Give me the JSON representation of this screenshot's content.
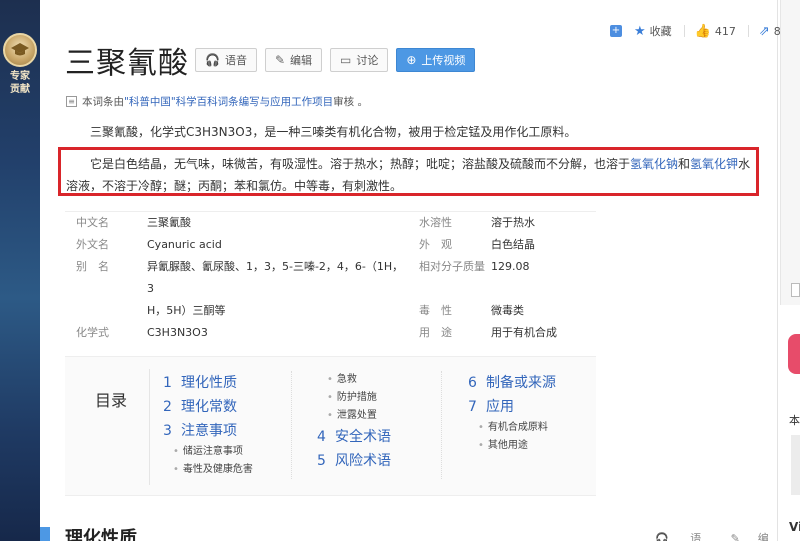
{
  "sidebar": {
    "expert_label": "专家贡献",
    "expert_line1": "专家",
    "expert_line2": "贡献"
  },
  "top_actions": {
    "favorite": "收藏",
    "likes": "417",
    "shares": "8"
  },
  "title": "三聚氰酸",
  "title_buttons": {
    "voice": "语音",
    "edit": "编辑",
    "discuss": "讨论",
    "upload_video": "上传视频"
  },
  "review": {
    "prefix": "本词条由",
    "link": "\"科普中国\"科学百科词条编写与应用工作项目",
    "suffix": " 审核 。"
  },
  "paragraphs": {
    "p1": "三聚氰酸，化学式C3H3N3O3，是一种三嗪类有机化合物，被用于检定锰及用作化工原料。",
    "p2_a": "它是白色结晶，无气味，味微苦，有吸湿性。溶于热水；热醇；吡啶；溶盐酸及硫酸而不分解，也溶于",
    "p2_link1": "氢氧化钠",
    "p2_mid": "和",
    "p2_link2": "氢氧化钾",
    "p2_b": "水溶液，不溶于冷醇；醚；丙酮；苯和氯仿。中等毒，有刺激性。"
  },
  "info_table": {
    "rows": [
      {
        "k": "中文名",
        "v": "三聚氰酸",
        "k2": "水溶性",
        "v2": "溶于热水"
      },
      {
        "k": "外文名",
        "v": "Cyanuric acid",
        "k2": "外　观",
        "v2": "白色结晶"
      },
      {
        "k": "别　名",
        "v": "异氰脲酸、氰尿酸、1，3，5-三嗪-2，4，6-（1H，3",
        "k2": "相对分子质量",
        "v2": "129.08"
      },
      {
        "k": "",
        "v": "H，5H）三酮等",
        "k2": "毒　性",
        "v2": "微毒类"
      },
      {
        "k": "化学式",
        "v": "C3H3N3O3",
        "k2": "用　途",
        "v2": "用于有机合成"
      }
    ]
  },
  "toc": {
    "title": "目录",
    "col1": [
      {
        "num": "1",
        "label": "理化性质"
      },
      {
        "num": "2",
        "label": "理化常数"
      },
      {
        "num": "3",
        "label": "注意事项"
      }
    ],
    "col1_subs": [
      "储运注意事项",
      "毒性及健康危害"
    ],
    "col2_subs": [
      "急救",
      "防护措施",
      "泄露处置"
    ],
    "col2": [
      {
        "num": "4",
        "label": "安全术语"
      },
      {
        "num": "5",
        "label": "风险术语"
      }
    ],
    "col3": [
      {
        "num": "6",
        "label": "制备或来源"
      },
      {
        "num": "7",
        "label": "应用"
      }
    ],
    "col3_subs": [
      "有机合成原料",
      "其他用途"
    ]
  },
  "section": {
    "title": "理化性质",
    "voice": "语音",
    "edit": "编辑"
  },
  "right_panel": {
    "char1": "本",
    "char2": "Vi"
  }
}
